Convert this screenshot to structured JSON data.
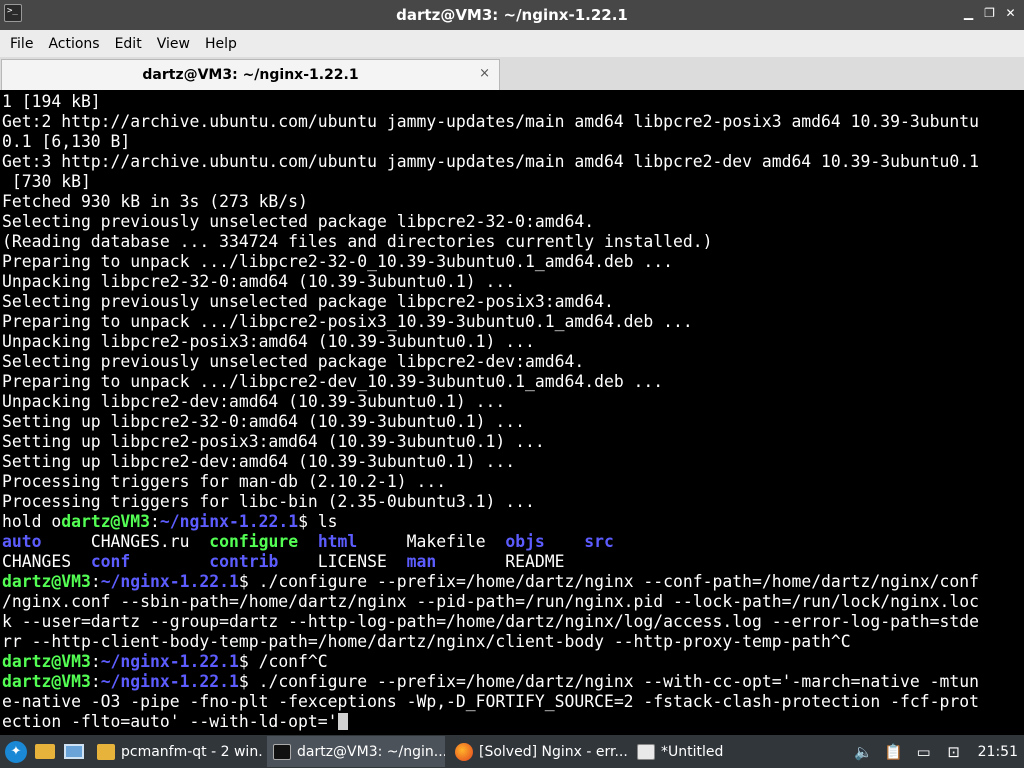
{
  "window": {
    "title": "dartz@VM3: ~/nginx-1.22.1",
    "app_icon": ">_",
    "buttons": [
      "minimize",
      "maximize",
      "close"
    ]
  },
  "menu": [
    "File",
    "Actions",
    "Edit",
    "View",
    "Help"
  ],
  "tab": {
    "label": "dartz@VM3: ~/nginx-1.22.1",
    "close": "×"
  },
  "terminal": {
    "lines": [
      [
        {
          "t": "1 [194 kB]",
          "c": "plain"
        }
      ],
      [
        {
          "t": "Get:2 http://archive.ubuntu.com/ubuntu jammy-updates/main amd64 libpcre2-posix3 amd64 10.39-3ubuntu",
          "c": "plain"
        }
      ],
      [
        {
          "t": "0.1 [6,130 B]",
          "c": "plain"
        }
      ],
      [
        {
          "t": "Get:3 http://archive.ubuntu.com/ubuntu jammy-updates/main amd64 libpcre2-dev amd64 10.39-3ubuntu0.1",
          "c": "plain"
        }
      ],
      [
        {
          "t": " [730 kB]",
          "c": "plain"
        }
      ],
      [
        {
          "t": "Fetched 930 kB in 3s (273 kB/s)",
          "c": "plain"
        }
      ],
      [
        {
          "t": "Selecting previously unselected package libpcre2-32-0:amd64.",
          "c": "plain"
        }
      ],
      [
        {
          "t": "(Reading database ... 334724 files and directories currently installed.)",
          "c": "plain"
        }
      ],
      [
        {
          "t": "Preparing to unpack .../libpcre2-32-0_10.39-3ubuntu0.1_amd64.deb ...",
          "c": "plain"
        }
      ],
      [
        {
          "t": "Unpacking libpcre2-32-0:amd64 (10.39-3ubuntu0.1) ...",
          "c": "plain"
        }
      ],
      [
        {
          "t": "Selecting previously unselected package libpcre2-posix3:amd64.",
          "c": "plain"
        }
      ],
      [
        {
          "t": "Preparing to unpack .../libpcre2-posix3_10.39-3ubuntu0.1_amd64.deb ...",
          "c": "plain"
        }
      ],
      [
        {
          "t": "Unpacking libpcre2-posix3:amd64 (10.39-3ubuntu0.1) ...",
          "c": "plain"
        }
      ],
      [
        {
          "t": "Selecting previously unselected package libpcre2-dev:amd64.",
          "c": "plain"
        }
      ],
      [
        {
          "t": "Preparing to unpack .../libpcre2-dev_10.39-3ubuntu0.1_amd64.deb ...",
          "c": "plain"
        }
      ],
      [
        {
          "t": "Unpacking libpcre2-dev:amd64 (10.39-3ubuntu0.1) ...",
          "c": "plain"
        }
      ],
      [
        {
          "t": "Setting up libpcre2-32-0:amd64 (10.39-3ubuntu0.1) ...",
          "c": "plain"
        }
      ],
      [
        {
          "t": "Setting up libpcre2-posix3:amd64 (10.39-3ubuntu0.1) ...",
          "c": "plain"
        }
      ],
      [
        {
          "t": "Setting up libpcre2-dev:amd64 (10.39-3ubuntu0.1) ...",
          "c": "plain"
        }
      ],
      [
        {
          "t": "Processing triggers for man-db (2.10.2-1) ...",
          "c": "plain"
        }
      ],
      [
        {
          "t": "Processing triggers for libc-bin (2.35-0ubuntu3.1) ...",
          "c": "plain"
        }
      ],
      [
        {
          "t": "hold o",
          "c": "plain"
        },
        {
          "t": "dartz@VM3",
          "c": "green"
        },
        {
          "t": ":",
          "c": "plain"
        },
        {
          "t": "~/nginx-1.22.1",
          "c": "blue"
        },
        {
          "t": "$ ls",
          "c": "plain"
        }
      ],
      [
        {
          "t": "auto",
          "c": "blue"
        },
        {
          "t": "     CHANGES.ru  ",
          "c": "plain"
        },
        {
          "t": "configure",
          "c": "green"
        },
        {
          "t": "  ",
          "c": "plain"
        },
        {
          "t": "html",
          "c": "blue"
        },
        {
          "t": "     Makefile  ",
          "c": "plain"
        },
        {
          "t": "objs",
          "c": "blue"
        },
        {
          "t": "    ",
          "c": "plain"
        },
        {
          "t": "src",
          "c": "blue"
        }
      ],
      [
        {
          "t": "CHANGES  ",
          "c": "plain"
        },
        {
          "t": "conf",
          "c": "blue"
        },
        {
          "t": "        ",
          "c": "plain"
        },
        {
          "t": "contrib",
          "c": "blue"
        },
        {
          "t": "    LICENSE  ",
          "c": "plain"
        },
        {
          "t": "man",
          "c": "blue"
        },
        {
          "t": "       README",
          "c": "plain"
        }
      ],
      [
        {
          "t": "dartz@VM3",
          "c": "green"
        },
        {
          "t": ":",
          "c": "plain"
        },
        {
          "t": "~/nginx-1.22.1",
          "c": "blue"
        },
        {
          "t": "$ ./configure --prefix=/home/dartz/nginx --conf-path=/home/dartz/nginx/conf",
          "c": "plain"
        }
      ],
      [
        {
          "t": "/nginx.conf --sbin-path=/home/dartz/nginx --pid-path=/run/nginx.pid --lock-path=/run/lock/nginx.loc",
          "c": "plain"
        }
      ],
      [
        {
          "t": "k --user=dartz --group=dartz --http-log-path=/home/dartz/nginx/log/access.log --error-log-path=stde",
          "c": "plain"
        }
      ],
      [
        {
          "t": "rr --http-client-body-temp-path=/home/dartz/nginx/client-body --http-proxy-temp-path^C",
          "c": "plain"
        }
      ],
      [
        {
          "t": "dartz@VM3",
          "c": "green"
        },
        {
          "t": ":",
          "c": "plain"
        },
        {
          "t": "~/nginx-1.22.1",
          "c": "blue"
        },
        {
          "t": "$ /conf^C",
          "c": "plain"
        }
      ],
      [
        {
          "t": "dartz@VM3",
          "c": "green"
        },
        {
          "t": ":",
          "c": "plain"
        },
        {
          "t": "~/nginx-1.22.1",
          "c": "blue"
        },
        {
          "t": "$ ./configure --prefix=/home/dartz/nginx --with-cc-opt='-march=native -mtun",
          "c": "plain"
        }
      ],
      [
        {
          "t": "e-native -O3 -pipe -fno-plt -fexceptions -Wp,-D_FORTIFY_SOURCE=2 -fstack-clash-protection -fcf-prot",
          "c": "plain"
        }
      ],
      [
        {
          "t": "ection -flto=auto' --with-ld-opt='",
          "c": "plain"
        },
        {
          "t": "CURSOR",
          "c": "cursor"
        }
      ]
    ]
  },
  "taskbar": {
    "tasks": [
      {
        "label": "pcmanfm-qt - 2 win...",
        "icon": "folder-icon",
        "active": false
      },
      {
        "label": "dartz@VM3: ~/ngin...",
        "icon": "terminal-icon",
        "active": true
      },
      {
        "label": "[Solved] Nginx - err...",
        "icon": "firefox-icon",
        "active": false
      },
      {
        "label": "*Untitled",
        "icon": "text-editor-icon",
        "active": false
      }
    ],
    "clock": "21:51"
  }
}
